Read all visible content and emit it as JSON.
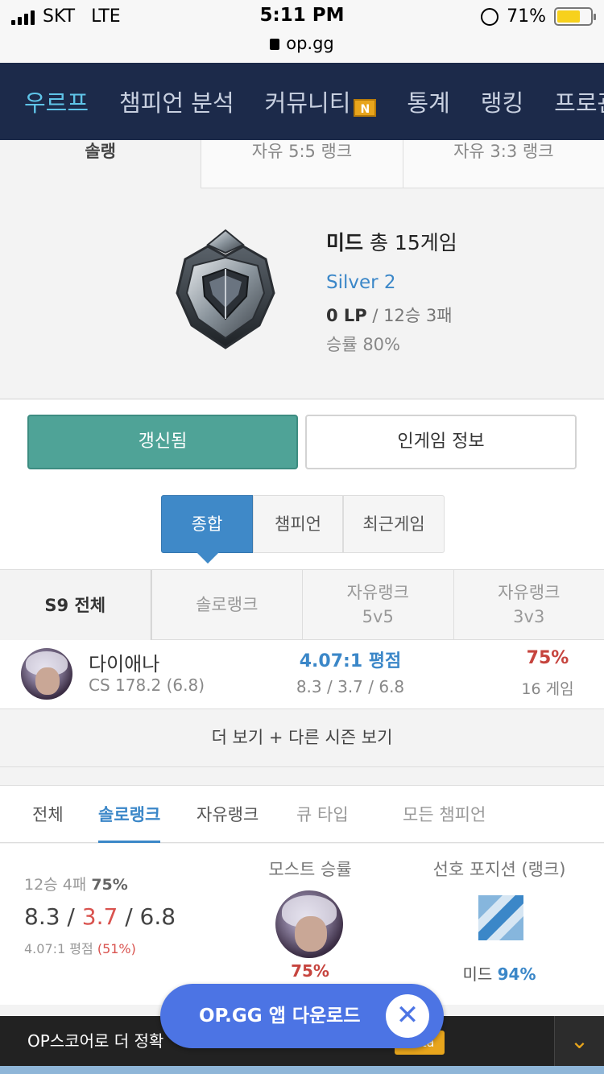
{
  "status_bar": {
    "carrier": "SKT",
    "network": "LTE",
    "time": "5:11 PM",
    "url": "op.gg",
    "battery": "71%"
  },
  "nav": {
    "items": [
      "우르프",
      "챔피언 분석",
      "커뮤니티",
      "통계",
      "랭킹",
      "프로관"
    ],
    "new_badge": "N"
  },
  "queue_tabs": [
    "솔랭",
    "자유 5:5 랭크",
    "자유 3:3 랭크"
  ],
  "tier": {
    "position": "미드",
    "games": "총 15게임",
    "tier_name": "Silver 2",
    "lp": "0 LP",
    "record": "/ 12승 3패",
    "winrate": "승률 80%"
  },
  "buttons": {
    "renew": "갱신됨",
    "ingame": "인게임 정보"
  },
  "segments": [
    "종합",
    "챔피언",
    "최근게임"
  ],
  "season_tabs": [
    "S9 전체",
    "솔로랭크",
    "자유랭크\n5v5",
    "자유랭크\n3v3"
  ],
  "season_tab_lines": {
    "t3a": "자유랭크",
    "t3b": "5v5",
    "t4a": "자유랭크",
    "t4b": "3v3"
  },
  "champion_row": {
    "name": "다이애나",
    "cs": "CS 178.2 (6.8)",
    "kda_ratio": "4.07:1 평점",
    "kda": "8.3 / 3.7 / 6.8",
    "winrate": "75%",
    "games": "16 게임"
  },
  "more_label": "더 보기 + 다른 시즌 보기",
  "filter_tabs": [
    "전체",
    "솔로랭크",
    "자유랭크",
    "큐 타입",
    "모든 챔피언"
  ],
  "summary": {
    "record_prefix": "12승 4패",
    "record_pct": "75%",
    "kills": "8.3",
    "deaths": "3.7",
    "assists": "6.8",
    "ratio": "4.07:1 평점",
    "ratio_pct": "(51%)",
    "most_winrate_label": "모스트 승률",
    "most_winrate_value": "75%",
    "preferred_position_label": "선호 포지션 (랭크)",
    "preferred_position": "미드",
    "preferred_position_pct": "94%"
  },
  "download_banner": {
    "text": "OP.GG 앱 다운로드",
    "close": "✕"
  },
  "bottom_bar": {
    "text": "OP스코어로 더 정확",
    "beta": "Beta",
    "chevron": "⌄"
  },
  "colors": {
    "nav_bg": "#1c2a4a",
    "accent_blue": "#3b87c8",
    "renew_green": "#4fa397",
    "red": "#c6443e",
    "banner_blue": "#4c74e4"
  }
}
